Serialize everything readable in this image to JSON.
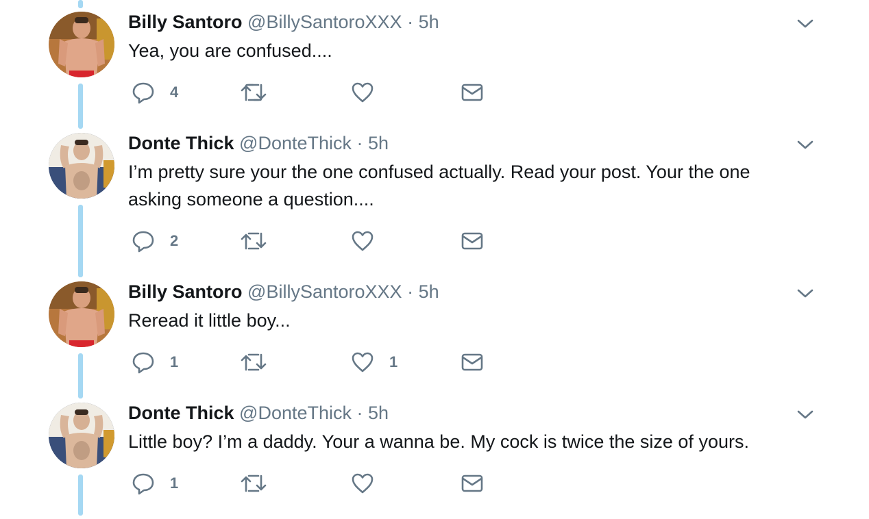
{
  "tweets": [
    {
      "name": "Billy Santoro",
      "handle": "@BillySantoroXXX",
      "separator": "·",
      "time": "5h",
      "text": "Yea, you are confused....",
      "reply_count": "4",
      "retweet_count": "",
      "like_count": "",
      "avatar": "billy-avatar"
    },
    {
      "name": "Donte Thick",
      "handle": "@DonteThick",
      "separator": "·",
      "time": "5h",
      "text": "I’m pretty sure your the one confused actually. Read your post. Your the one asking someone a question....",
      "reply_count": "2",
      "retweet_count": "",
      "like_count": "",
      "avatar": "donte-avatar"
    },
    {
      "name": "Billy Santoro",
      "handle": "@BillySantoroXXX",
      "separator": "·",
      "time": "5h",
      "text": "Reread it little boy...",
      "reply_count": "1",
      "retweet_count": "",
      "like_count": "1",
      "avatar": "billy-avatar"
    },
    {
      "name": "Donte Thick",
      "handle": "@DonteThick",
      "separator": "·",
      "time": "5h",
      "text": "Little boy? I’m a daddy. Your a wanna be. My cock is twice the size of yours.",
      "reply_count": "1",
      "retweet_count": "",
      "like_count": "",
      "avatar": "donte-avatar"
    }
  ],
  "icons": {
    "reply": "reply-icon",
    "retweet": "retweet-icon",
    "like": "like-icon",
    "message": "direct-message-icon",
    "menu": "chevron-down-icon"
  },
  "colors": {
    "thread_line": "#a5d8f3",
    "icon": "#657786",
    "text": "#14171a",
    "muted": "#657786"
  }
}
